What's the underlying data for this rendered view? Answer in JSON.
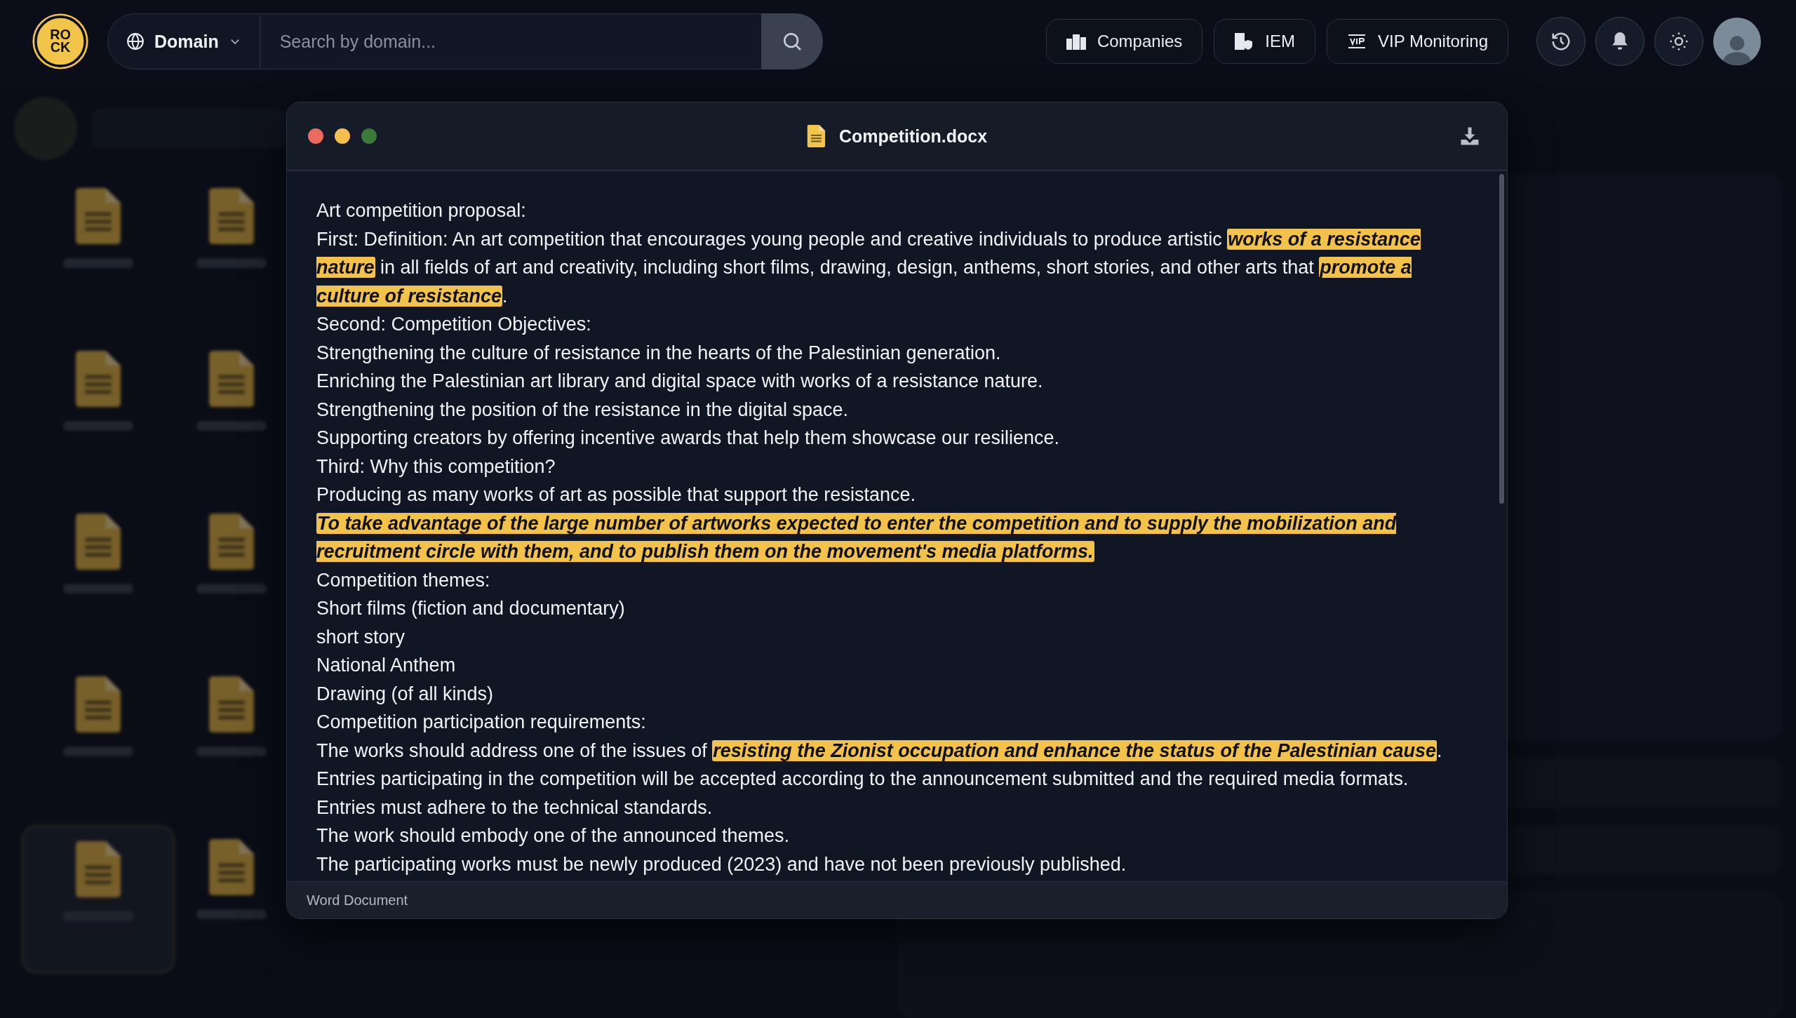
{
  "logo": {
    "line_1": "RO",
    "line_2": "CK"
  },
  "search": {
    "scope": "Domain",
    "placeholder": "Search by domain..."
  },
  "nav_buttons": [
    {
      "kind": "companies",
      "label": "Companies"
    },
    {
      "kind": "iem",
      "label": "IEM"
    },
    {
      "kind": "vip",
      "label": "VIP Monitoring"
    }
  ],
  "background_files": [
    {
      "selected": false
    },
    {
      "selected": false
    },
    {
      "selected": false
    },
    {
      "selected": false
    },
    {
      "selected": false
    },
    {
      "selected": false
    },
    {
      "selected": false
    },
    {
      "selected": false
    },
    {
      "selected": true
    },
    {
      "selected": false
    }
  ],
  "document": {
    "title": "Competition.docx",
    "footer": "Word Document",
    "paragraphs": [
      {
        "segments": [
          {
            "text": "Art competition proposal:",
            "highlighted": false
          }
        ]
      },
      {
        "segments": [
          {
            "text": "First: Definition: An art competition that encourages young people and creative individuals to produce artistic ",
            "highlighted": false
          },
          {
            "text": "works of a resistance nature",
            "highlighted": true
          },
          {
            "text": " in all fields of art and creativity, including short films, drawing, design, anthems, short stories, and other arts that ",
            "highlighted": false
          },
          {
            "text": "promote a culture of resistance",
            "highlighted": true
          },
          {
            "text": ".",
            "highlighted": false
          }
        ]
      },
      {
        "segments": [
          {
            "text": "Second: Competition Objectives:",
            "highlighted": false
          }
        ]
      },
      {
        "segments": [
          {
            "text": "Strengthening the culture of resistance in the hearts of the Palestinian generation.",
            "highlighted": false
          }
        ]
      },
      {
        "segments": [
          {
            "text": "Enriching the Palestinian art library and digital space with works of a resistance nature.",
            "highlighted": false
          }
        ]
      },
      {
        "segments": [
          {
            "text": "Strengthening the position of the resistance in the digital space.",
            "highlighted": false
          }
        ]
      },
      {
        "segments": [
          {
            "text": "Supporting creators by offering incentive awards that help them showcase our resilience.",
            "highlighted": false
          }
        ]
      },
      {
        "segments": [
          {
            "text": "Third: Why this competition?",
            "highlighted": false
          }
        ]
      },
      {
        "segments": [
          {
            "text": "Producing as many works of art as possible that support the resistance.",
            "highlighted": false
          }
        ]
      },
      {
        "segments": [
          {
            "text": "To take advantage of the large number of artworks expected to enter the competition and to supply the mobilization and recruitment circle with them, and to publish them on the movement's media platforms.",
            "highlighted": true
          }
        ]
      },
      {
        "segments": [
          {
            "text": "Competition themes:",
            "highlighted": false
          }
        ]
      },
      {
        "segments": [
          {
            "text": "Short films (fiction and documentary)",
            "highlighted": false
          }
        ]
      },
      {
        "segments": [
          {
            "text": "short story",
            "highlighted": false
          }
        ]
      },
      {
        "segments": [
          {
            "text": "National Anthem",
            "highlighted": false
          }
        ]
      },
      {
        "segments": [
          {
            "text": "Drawing (of all kinds)",
            "highlighted": false
          }
        ]
      },
      {
        "segments": [
          {
            "text": "Competition participation requirements:",
            "highlighted": false
          }
        ]
      },
      {
        "segments": [
          {
            "text": "The works should address one of the issues of ",
            "highlighted": false
          },
          {
            "text": "resisting the Zionist occupation and enhance the status of the Palestinian cause",
            "highlighted": true
          },
          {
            "text": ".",
            "highlighted": false
          }
        ]
      },
      {
        "segments": [
          {
            "text": "Entries participating in the competition will be accepted according to the announcement submitted and the required media formats.",
            "highlighted": false
          }
        ]
      },
      {
        "segments": [
          {
            "text": "Entries must adhere to the technical standards.",
            "highlighted": false
          }
        ]
      },
      {
        "segments": [
          {
            "text": "The work should embody one of the announced themes.",
            "highlighted": false
          }
        ]
      },
      {
        "segments": [
          {
            "text": "The participating works must be newly produced (2023) and have not been previously published.",
            "highlighted": false
          }
        ]
      }
    ]
  }
}
